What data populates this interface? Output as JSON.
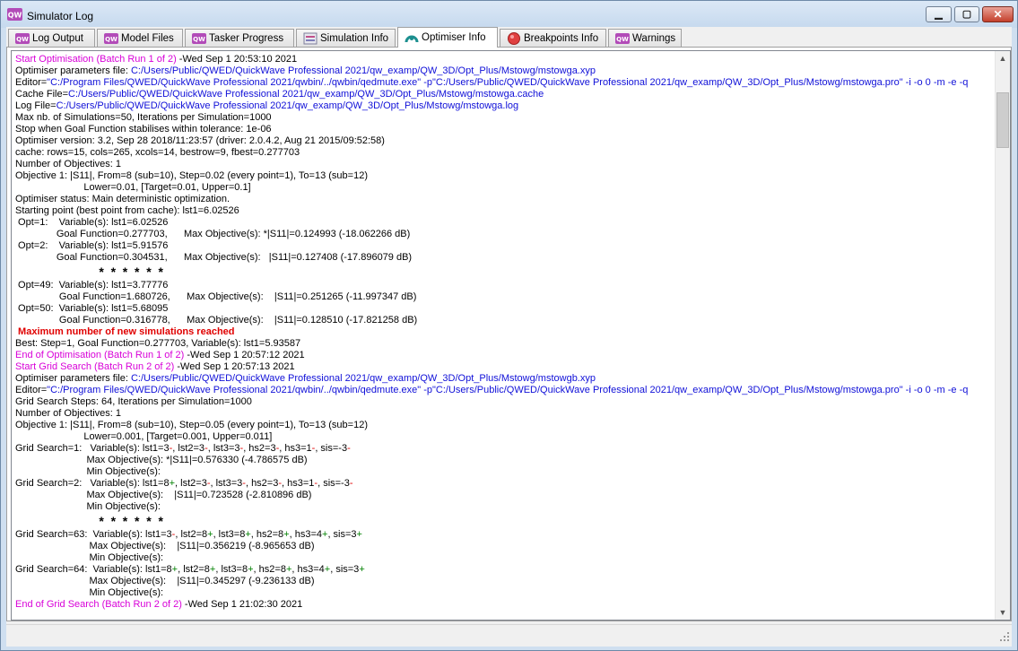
{
  "window": {
    "title": "Simulator Log"
  },
  "tabs": [
    {
      "label": "Log Output",
      "icon": "qw-logo-icon"
    },
    {
      "label": "Model Files",
      "icon": "qw-logo-icon"
    },
    {
      "label": "Tasker Progress",
      "icon": "qw-logo-icon"
    },
    {
      "label": "Simulation Info",
      "icon": "simulation-info-icon"
    },
    {
      "label": "Optimiser Info",
      "icon": "optimiser-icon",
      "active": true
    },
    {
      "label": "Breakpoints Info",
      "icon": "breakpoint-icon"
    },
    {
      "label": "Warnings",
      "icon": "qw-logo-icon"
    }
  ],
  "colors": {
    "magenta": "#d800d8",
    "blue": "#1010d8",
    "red": "#e00000",
    "green": "#008000",
    "black": "#000000"
  },
  "log": [
    {
      "segs": [
        {
          "t": "Start Optimisation (Batch Run 1 of 2)",
          "c": "magenta"
        },
        {
          "t": " -Wed Sep 1 20:53:10 2021"
        }
      ]
    },
    {
      "segs": [
        {
          "t": "Optimiser parameters file: "
        },
        {
          "t": "C:/Users/Public/QWED/QuickWave Professional 2021/qw_examp/QW_3D/Opt_Plus/Mstowg/mstowga.xyp",
          "c": "blue"
        }
      ]
    },
    {
      "segs": [
        {
          "t": "Editor="
        },
        {
          "t": "\"C:/Program Files/QWED/QuickWave Professional 2021/qwbin/../qwbin/qedmute.exe\" -p\"C:/Users/Public/QWED/QuickWave Professional 2021/qw_examp/QW_3D/Opt_Plus/Mstowg/mstowga.pro\" -i -o 0 -m -e -q",
          "c": "blue"
        }
      ]
    },
    {
      "segs": [
        {
          "t": "Cache File="
        },
        {
          "t": "C:/Users/Public/QWED/QuickWave Professional 2021/qw_examp/QW_3D/Opt_Plus/Mstowg/mstowga.cache",
          "c": "blue"
        }
      ]
    },
    {
      "segs": [
        {
          "t": "Log File="
        },
        {
          "t": "C:/Users/Public/QWED/QuickWave Professional 2021/qw_examp/QW_3D/Opt_Plus/Mstowg/mstowga.log",
          "c": "blue"
        }
      ]
    },
    {
      "segs": [
        {
          "t": "Max nb. of Simulations=50, Iterations per Simulation=1000"
        }
      ]
    },
    {
      "segs": [
        {
          "t": "Stop when Goal Function stabilises within tolerance: 1e-06"
        }
      ]
    },
    {
      "segs": [
        {
          "t": "Optimiser version: 3.2, Sep 28 2018/11:23:57 (driver: 2.0.4.2, Aug 21 2015/09:52:58)"
        }
      ]
    },
    {
      "segs": [
        {
          "t": "cache: rows=15, cols=265, xcols=14, bestrow=9, fbest=0.277703"
        }
      ]
    },
    {
      "segs": [
        {
          "t": "Number of Objectives: 1"
        }
      ]
    },
    {
      "segs": [
        {
          "t": "Objective 1: |S11|, From=8 (sub=10), Step=0.02 (every point=1), To=13 (sub=12)"
        }
      ]
    },
    {
      "segs": [
        {
          "t": "                         Lower=0.01, [Target=0.01, Upper=0.1]"
        }
      ]
    },
    {
      "segs": [
        {
          "t": "Optimiser status: Main deterministic optimization."
        }
      ]
    },
    {
      "segs": [
        {
          "t": "Starting point (best point from cache): lst1=6.02526"
        }
      ]
    },
    {
      "segs": [
        {
          "t": " Opt=1:    Variable(s): lst1=6.02526"
        }
      ]
    },
    {
      "segs": [
        {
          "t": "               Goal Function=0.277703,      Max Objective(s): *|S11|=0.124993 (-18.062266 dB)"
        }
      ]
    },
    {
      "segs": [
        {
          "t": " Opt=2:    Variable(s): lst1=5.91576"
        }
      ]
    },
    {
      "segs": [
        {
          "t": "               Goal Function=0.304531,      Max Objective(s):   |S11|=0.127408 (-17.896079 dB)"
        }
      ]
    },
    {
      "type": "stars",
      "segs": [
        {
          "t": "                        *  *  *  *  *  *"
        }
      ]
    },
    {
      "segs": [
        {
          "t": " Opt=49:  Variable(s): lst1=3.77776"
        }
      ]
    },
    {
      "segs": [
        {
          "t": "                Goal Function=1.680726,      Max Objective(s):    |S11|=0.251265 (-11.997347 dB)"
        }
      ]
    },
    {
      "segs": [
        {
          "t": " Opt=50:  Variable(s): lst1=5.68095"
        }
      ]
    },
    {
      "segs": [
        {
          "t": "                Goal Function=0.316778,      Max Objective(s):    |S11|=0.128510 (-17.821258 dB)"
        }
      ]
    },
    {
      "type": "alert",
      "segs": [
        {
          "t": " Maximum number of new simulations reached",
          "c": "red"
        }
      ]
    },
    {
      "segs": [
        {
          "t": "Best: Step=1, Goal Function=0.277703, Variable(s): lst1=5.93587"
        }
      ]
    },
    {
      "segs": [
        {
          "t": "End of Optimisation (Batch Run 1 of 2)",
          "c": "magenta"
        },
        {
          "t": " -Wed Sep 1 20:57:12 2021"
        }
      ]
    },
    {
      "segs": [
        {
          "t": "Start Grid Search (Batch Run 2 of 2)",
          "c": "magenta"
        },
        {
          "t": " -Wed Sep 1 20:57:13 2021"
        }
      ]
    },
    {
      "segs": [
        {
          "t": "Optimiser parameters file: "
        },
        {
          "t": "C:/Users/Public/QWED/QuickWave Professional 2021/qw_examp/QW_3D/Opt_Plus/Mstowg/mstowgb.xyp",
          "c": "blue"
        }
      ]
    },
    {
      "segs": [
        {
          "t": "Editor="
        },
        {
          "t": "\"C:/Program Files/QWED/QuickWave Professional 2021/qwbin/../qwbin/qedmute.exe\" -p\"C:/Users/Public/QWED/QuickWave Professional 2021/qw_examp/QW_3D/Opt_Plus/Mstowg/mstowga.pro\" -i -o 0 -m -e -q",
          "c": "blue"
        }
      ]
    },
    {
      "segs": [
        {
          "t": "Grid Search Steps: 64, Iterations per Simulation=1000"
        }
      ]
    },
    {
      "segs": [
        {
          "t": "Number of Objectives: 1"
        }
      ]
    },
    {
      "segs": [
        {
          "t": "Objective 1: |S11|, From=8 (sub=10), Step=0.05 (every point=1), To=13 (sub=12)"
        }
      ]
    },
    {
      "segs": [
        {
          "t": "                         Lower=0.001, [Target=0.001, Upper=0.011]"
        }
      ]
    },
    {
      "segs": [
        {
          "t": "Grid Search=1:   Variable(s): lst1=3"
        },
        {
          "t": "-",
          "c": "red"
        },
        {
          "t": ", lst2=3"
        },
        {
          "t": "-",
          "c": "red"
        },
        {
          "t": ", lst3=3"
        },
        {
          "t": "-",
          "c": "red"
        },
        {
          "t": ", hs2=3"
        },
        {
          "t": "-",
          "c": "red"
        },
        {
          "t": ", hs3=1"
        },
        {
          "t": "-",
          "c": "red"
        },
        {
          "t": ", sis=-3"
        },
        {
          "t": "-",
          "c": "red"
        }
      ]
    },
    {
      "segs": [
        {
          "t": "                          Max Objective(s): *|S11|=0.576330 (-4.786575 dB)"
        }
      ]
    },
    {
      "segs": [
        {
          "t": "                          Min Objective(s):"
        }
      ]
    },
    {
      "segs": [
        {
          "t": "Grid Search=2:   Variable(s): lst1=8"
        },
        {
          "t": "+",
          "c": "green"
        },
        {
          "t": ", lst2=3"
        },
        {
          "t": "-",
          "c": "red"
        },
        {
          "t": ", lst3=3"
        },
        {
          "t": "-",
          "c": "red"
        },
        {
          "t": ", hs2=3"
        },
        {
          "t": "-",
          "c": "red"
        },
        {
          "t": ", hs3=1"
        },
        {
          "t": "-",
          "c": "red"
        },
        {
          "t": ", sis=-3"
        },
        {
          "t": "-",
          "c": "red"
        }
      ]
    },
    {
      "segs": [
        {
          "t": "                          Max Objective(s):    |S11|=0.723528 (-2.810896 dB)"
        }
      ]
    },
    {
      "segs": [
        {
          "t": "                          Min Objective(s):"
        }
      ]
    },
    {
      "type": "stars",
      "segs": [
        {
          "t": "                        *  *  *  *  *  *"
        }
      ]
    },
    {
      "segs": [
        {
          "t": "Grid Search=63:  Variable(s): lst1=3"
        },
        {
          "t": "-",
          "c": "red"
        },
        {
          "t": ", lst2=8"
        },
        {
          "t": "+",
          "c": "green"
        },
        {
          "t": ", lst3=8"
        },
        {
          "t": "+",
          "c": "green"
        },
        {
          "t": ", hs2=8"
        },
        {
          "t": "+",
          "c": "green"
        },
        {
          "t": ", hs3=4"
        },
        {
          "t": "+",
          "c": "green"
        },
        {
          "t": ", sis=3"
        },
        {
          "t": "+",
          "c": "green"
        }
      ]
    },
    {
      "segs": [
        {
          "t": "                           Max Objective(s):    |S11|=0.356219 (-8.965653 dB)"
        }
      ]
    },
    {
      "segs": [
        {
          "t": "                           Min Objective(s):"
        }
      ]
    },
    {
      "segs": [
        {
          "t": "Grid Search=64:  Variable(s): lst1=8"
        },
        {
          "t": "+",
          "c": "green"
        },
        {
          "t": ", lst2=8"
        },
        {
          "t": "+",
          "c": "green"
        },
        {
          "t": ", lst3=8"
        },
        {
          "t": "+",
          "c": "green"
        },
        {
          "t": ", hs2=8"
        },
        {
          "t": "+",
          "c": "green"
        },
        {
          "t": ", hs3=4"
        },
        {
          "t": "+",
          "c": "green"
        },
        {
          "t": ", sis=3"
        },
        {
          "t": "+",
          "c": "green"
        }
      ]
    },
    {
      "segs": [
        {
          "t": "                           Max Objective(s):    |S11|=0.345297 (-9.236133 dB)"
        }
      ]
    },
    {
      "segs": [
        {
          "t": "                           Min Objective(s):"
        }
      ]
    },
    {
      "segs": [
        {
          "t": "End of Grid Search (Batch Run 2 of 2)",
          "c": "magenta"
        },
        {
          "t": " -Wed Sep 1 21:02:30 2021"
        }
      ]
    }
  ]
}
